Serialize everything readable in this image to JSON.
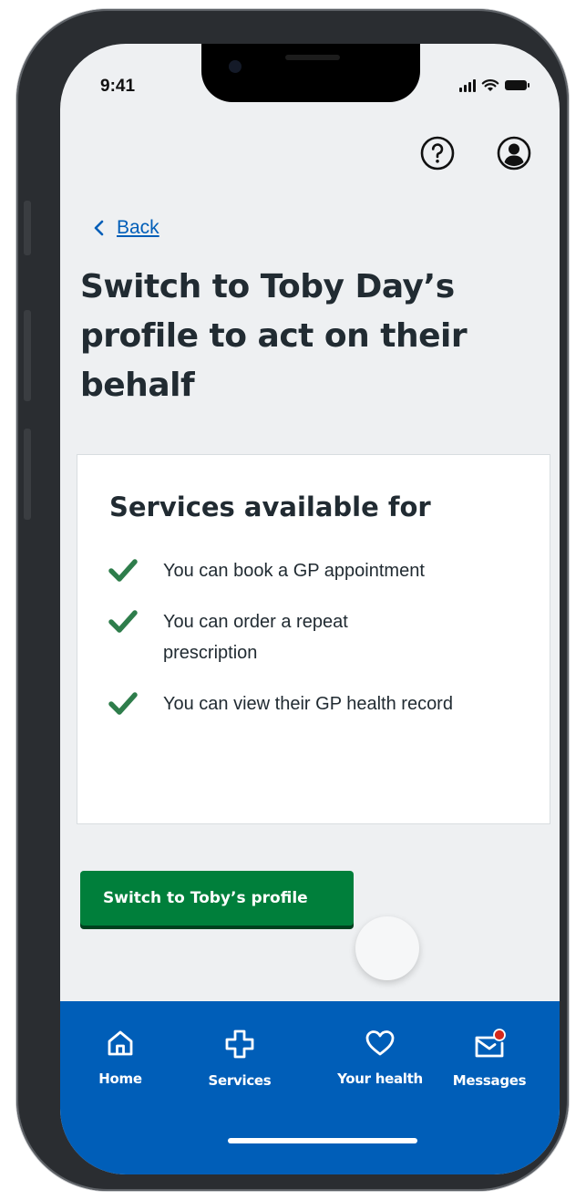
{
  "status_bar": {
    "time": "9:41"
  },
  "header": {
    "help_icon": "question-circle-icon",
    "account_icon": "user-circle-icon"
  },
  "navigation": {
    "back_label": "Back"
  },
  "page": {
    "title": "Switch to Toby Day’s profile to act on their behalf"
  },
  "services_card": {
    "title": "Services available for",
    "items": [
      {
        "text": "You can book a GP appointment"
      },
      {
        "text": "You can order a repeat prescription"
      },
      {
        "text": "You can view their GP health record"
      }
    ]
  },
  "primary_action": {
    "label": "Switch to Toby’s profile"
  },
  "tab_bar": {
    "tabs": [
      {
        "label": "Home",
        "icon": "home-icon"
      },
      {
        "label": "Services",
        "icon": "plus-cross-icon"
      },
      {
        "label": "Your health",
        "icon": "heart-icon"
      },
      {
        "label": "Messages",
        "icon": "envelope-icon"
      }
    ]
  },
  "colors": {
    "nhs_blue": "#005eb8",
    "button_green": "#007f3b",
    "check_green": "#2e7d4b",
    "text_dark": "#212b32",
    "background": "#eef0f2",
    "notification_red": "#d5281b"
  }
}
